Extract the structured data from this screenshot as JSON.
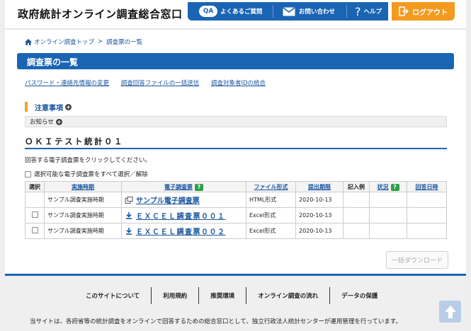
{
  "header": {
    "site_title": "政府統計オンライン調査総合窓口",
    "faq_badge": "QA",
    "faq_label": "よくあるご質問",
    "contact_label": "お問い合わせ",
    "help_label": "ヘルプ",
    "logout_label": "ログアウト"
  },
  "breadcrumb": {
    "home": "オンライン調査トップ",
    "separator": ">",
    "current": "調査票の一覧"
  },
  "page_title": "調査票の一覧",
  "links": [
    "パスワード・連絡先情報の変更",
    "調査回答ファイルの一括送信",
    "調査対象者IDの統合"
  ],
  "notes": {
    "heading": "注意事項",
    "notice": "お知らせ"
  },
  "survey": {
    "title": "ＯＫＩテスト統計０１",
    "instruction": "回答する電子調査票をクリックしてください。",
    "select_all_label": "選択可能な電子調査票をすべて選択／解除"
  },
  "table": {
    "headers": {
      "select": "選択",
      "period": "実施時期",
      "form": "電子調査票",
      "format": "ファイル形式",
      "deadline": "提出期限",
      "example": "記入例",
      "status": "状況",
      "answered": "回答日時",
      "help_badge": "?"
    },
    "rows": [
      {
        "period": "サンプル調査実施時期",
        "form": "サンプル電子調査票",
        "format": "HTML形式",
        "deadline": "2020-10-13"
      },
      {
        "period": "サンプル調査実施時期",
        "form": "ＥＸＣＥＬ調査票００１",
        "format": "Excel形式",
        "deadline": "2020-10-13"
      },
      {
        "period": "サンプル調査実施時期",
        "form": "ＥＸＣＥＬ調査票００２",
        "format": "Excel形式",
        "deadline": "2020-10-13"
      }
    ]
  },
  "download_button": "一括ダウンロード",
  "footer": {
    "nav": [
      "このサイトについて",
      "利用規約",
      "推奨環境",
      "オンライン調査の流れ",
      "データの保護"
    ],
    "note": "当サイトは、各府省等の統計調査をオンラインで回答するための総合窓口として、独立行政法人統計センターが運用管理を行っています。"
  },
  "colors": {
    "brand_blue": "#1a64b4",
    "logout_orange": "#f39a1f",
    "help_green": "#2f9e44",
    "notes_accent": "#f5a623"
  }
}
